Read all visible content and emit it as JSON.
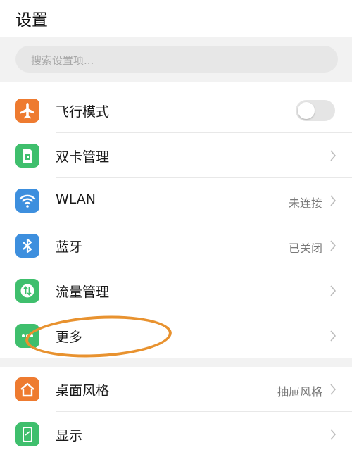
{
  "header": {
    "title": "设置"
  },
  "search": {
    "placeholder": "搜索设置项..."
  },
  "group1": [
    {
      "label": "飞行模式",
      "value": "",
      "icon": "airplane-icon",
      "color": "#ee7b30",
      "control": "toggle",
      "toggle_on": false
    },
    {
      "label": "双卡管理",
      "value": "",
      "icon": "sim-card-icon",
      "color": "#3fbf6d",
      "control": "chevron"
    },
    {
      "label": "WLAN",
      "value": "未连接",
      "icon": "wifi-icon",
      "color": "#3d8fde",
      "control": "chevron"
    },
    {
      "label": "蓝牙",
      "value": "已关闭",
      "icon": "bluetooth-icon",
      "color": "#3d8fde",
      "control": "chevron"
    },
    {
      "label": "流量管理",
      "value": "",
      "icon": "data-usage-icon",
      "color": "#3fbf6d",
      "control": "chevron"
    },
    {
      "label": "更多",
      "value": "",
      "icon": "more-icon",
      "color": "#3fbf6d",
      "control": "chevron"
    }
  ],
  "group2": [
    {
      "label": "桌面风格",
      "value": "抽屉风格",
      "icon": "home-icon",
      "color": "#ee7b30",
      "control": "chevron"
    },
    {
      "label": "显示",
      "value": "",
      "icon": "display-icon",
      "color": "#3fbf6d",
      "control": "chevron"
    }
  ],
  "annotation": {
    "color": "#e8922f",
    "target": "更多"
  }
}
